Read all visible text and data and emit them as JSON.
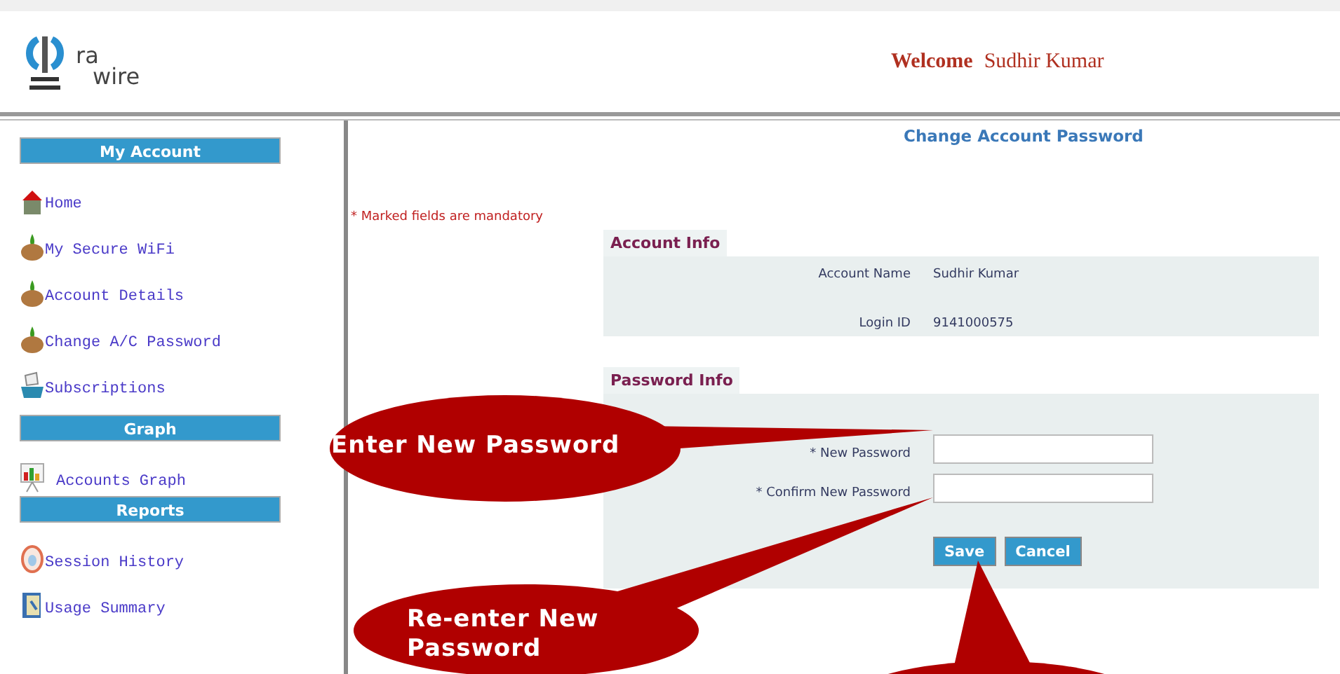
{
  "header": {
    "logo": {
      "top": "ra",
      "bottom": "wire"
    },
    "welcome": "Welcome",
    "user_name": "Sudhir Kumar"
  },
  "sidebar": {
    "sections": [
      {
        "title": "My Account",
        "items": [
          {
            "label": "Home"
          },
          {
            "label": "My Secure WiFi"
          },
          {
            "label": "Account Details"
          },
          {
            "label": "Change A/C Password"
          },
          {
            "label": "Subscriptions"
          }
        ]
      },
      {
        "title": "Graph",
        "items": [
          {
            "label": "Accounts Graph"
          }
        ]
      },
      {
        "title": "Reports",
        "items": [
          {
            "label": "Session History"
          },
          {
            "label": "Usage Summary"
          }
        ]
      }
    ]
  },
  "page": {
    "title": "Change Account Password",
    "mandatory_note": "* Marked fields are mandatory",
    "account_info": {
      "heading": "Account Info",
      "rows": [
        {
          "label": "Account Name",
          "value": "Sudhir Kumar"
        },
        {
          "label": "Login ID",
          "value": "9141000575"
        }
      ]
    },
    "password_info": {
      "heading": "Password Info",
      "fields": [
        {
          "label": "* New Password"
        },
        {
          "label": "* Confirm New Password"
        }
      ],
      "buttons": [
        "Save",
        "Cancel"
      ]
    }
  },
  "callouts": [
    {
      "text": "Enter New Password"
    },
    {
      "text": "Re-enter New Password"
    }
  ]
}
